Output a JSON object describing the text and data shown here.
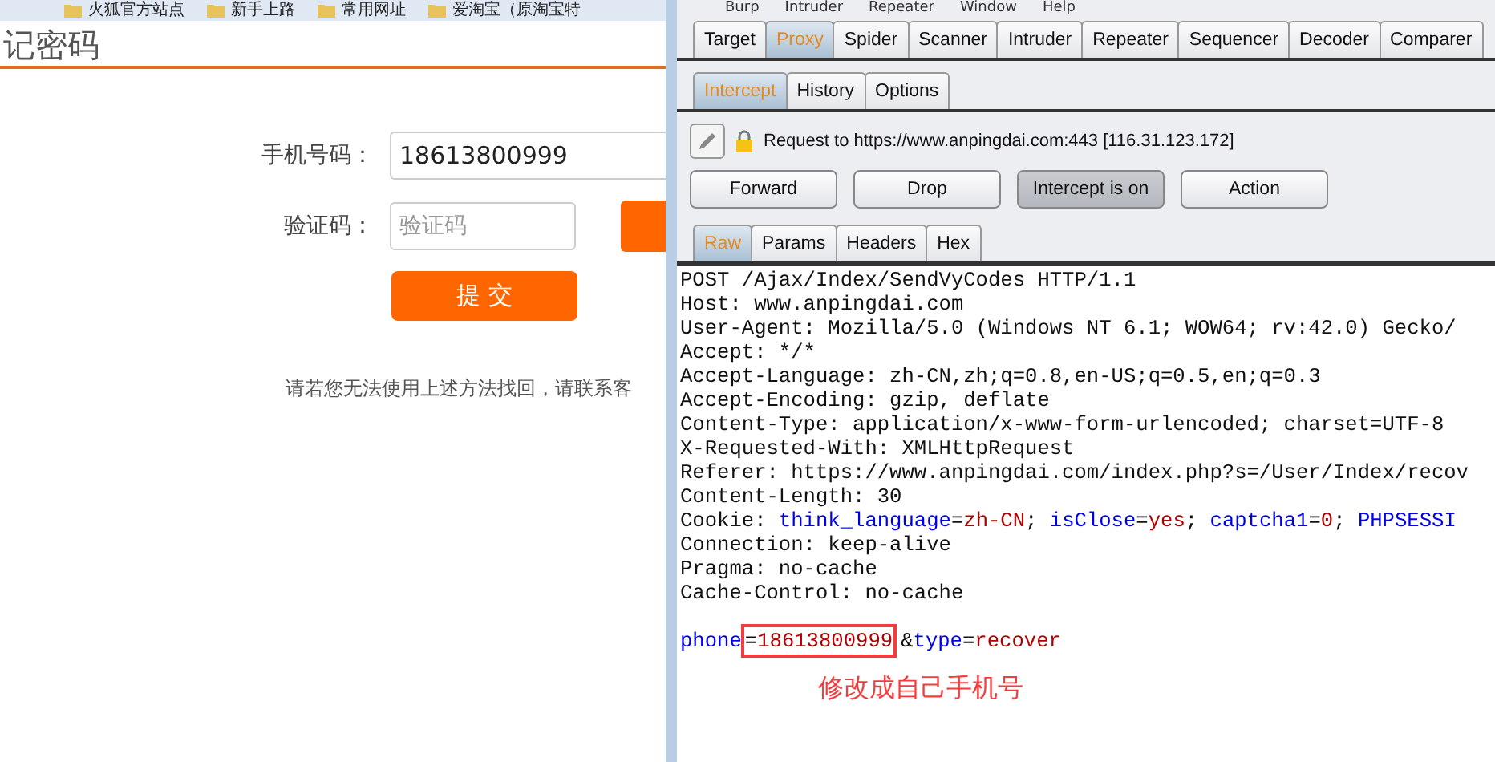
{
  "browser_bookmarks": [
    "火狐官方站点",
    "新手上路",
    "常用网址",
    "爱淘宝（原淘宝特"
  ],
  "page": {
    "title": "记密码",
    "phone_label": "手机号码：",
    "phone_value": "18613800999",
    "code_label": "验证码：",
    "code_placeholder": "验证码",
    "submit": "提 交",
    "footer": "请若您无法使用上述方法找回，请联系客"
  },
  "burp": {
    "menu": [
      "Burp",
      "Intruder",
      "Repeater",
      "Window",
      "Help"
    ],
    "tabs": [
      {
        "label": "Target",
        "selected": false
      },
      {
        "label": "Proxy",
        "selected": true
      },
      {
        "label": "Spider",
        "selected": false
      },
      {
        "label": "Scanner",
        "selected": false
      },
      {
        "label": "Intruder",
        "selected": false
      },
      {
        "label": "Repeater",
        "selected": false
      },
      {
        "label": "Sequencer",
        "selected": false
      },
      {
        "label": "Decoder",
        "selected": false
      },
      {
        "label": "Comparer",
        "selected": false
      }
    ],
    "subtabs": [
      {
        "label": "Intercept",
        "selected": true
      },
      {
        "label": "History",
        "selected": false
      },
      {
        "label": "Options",
        "selected": false
      }
    ],
    "request_to": "Request to https://www.anpingdai.com:443  [116.31.123.172]",
    "buttons": [
      {
        "label": "Forward",
        "selected": false
      },
      {
        "label": "Drop",
        "selected": false
      },
      {
        "label": "Intercept is on",
        "selected": true
      },
      {
        "label": "Action",
        "selected": false
      }
    ],
    "view_tabs": [
      {
        "label": "Raw",
        "selected": true
      },
      {
        "label": "Params",
        "selected": false
      },
      {
        "label": "Headers",
        "selected": false
      },
      {
        "label": "Hex",
        "selected": false
      }
    ],
    "lines": [
      {
        "kind": "text",
        "text": "POST /Ajax/Index/SendVyCodes HTTP/1.1"
      },
      {
        "kind": "text",
        "text": "Host: www.anpingdai.com"
      },
      {
        "kind": "text",
        "text": "User-Agent: Mozilla/5.0 (Windows NT 6.1; WOW64; rv:42.0) Gecko/"
      },
      {
        "kind": "text",
        "text": "Accept: */*"
      },
      {
        "kind": "text",
        "text": "Accept-Language: zh-CN,zh;q=0.8,en-US;q=0.5,en;q=0.3"
      },
      {
        "kind": "text",
        "text": "Accept-Encoding: gzip, deflate"
      },
      {
        "kind": "text",
        "text": "Content-Type: application/x-www-form-urlencoded; charset=UTF-8"
      },
      {
        "kind": "text",
        "text": "X-Requested-With: XMLHttpRequest"
      },
      {
        "kind": "text",
        "text": "Referer: https://www.anpingdai.com/index.php?s=/User/Index/recov"
      },
      {
        "kind": "text",
        "text": "Content-Length: 30"
      },
      {
        "kind": "tokens",
        "tokens": [
          {
            "kind": "plain",
            "t": "Cookie: "
          },
          {
            "kind": "name",
            "t": "think_language"
          },
          {
            "kind": "plain",
            "t": "="
          },
          {
            "kind": "value",
            "t": "zh-CN"
          },
          {
            "kind": "plain",
            "t": "; "
          },
          {
            "kind": "name",
            "t": "isClose"
          },
          {
            "kind": "plain",
            "t": "="
          },
          {
            "kind": "value",
            "t": "yes"
          },
          {
            "kind": "plain",
            "t": "; "
          },
          {
            "kind": "name",
            "t": "captcha1"
          },
          {
            "kind": "plain",
            "t": "="
          },
          {
            "kind": "value",
            "t": "0"
          },
          {
            "kind": "plain",
            "t": "; "
          },
          {
            "kind": "name",
            "t": "PHPSESSI"
          }
        ]
      },
      {
        "kind": "text",
        "text": "Connection: keep-alive"
      },
      {
        "kind": "text",
        "text": "Pragma: no-cache"
      },
      {
        "kind": "text",
        "text": "Cache-Control: no-cache"
      },
      {
        "kind": "blank"
      },
      {
        "kind": "tokens",
        "tokens": [
          {
            "kind": "name",
            "t": "phone"
          },
          {
            "kind": "boxed",
            "children": [
              {
                "kind": "plain",
                "t": "="
              },
              {
                "kind": "value",
                "t": "18613800999"
              }
            ]
          },
          {
            "kind": "plain",
            "t": "&"
          },
          {
            "kind": "name",
            "t": "type"
          },
          {
            "kind": "plain",
            "t": "="
          },
          {
            "kind": "value",
            "t": "recover"
          }
        ]
      }
    ],
    "annotation": "修改成自己手机号"
  }
}
